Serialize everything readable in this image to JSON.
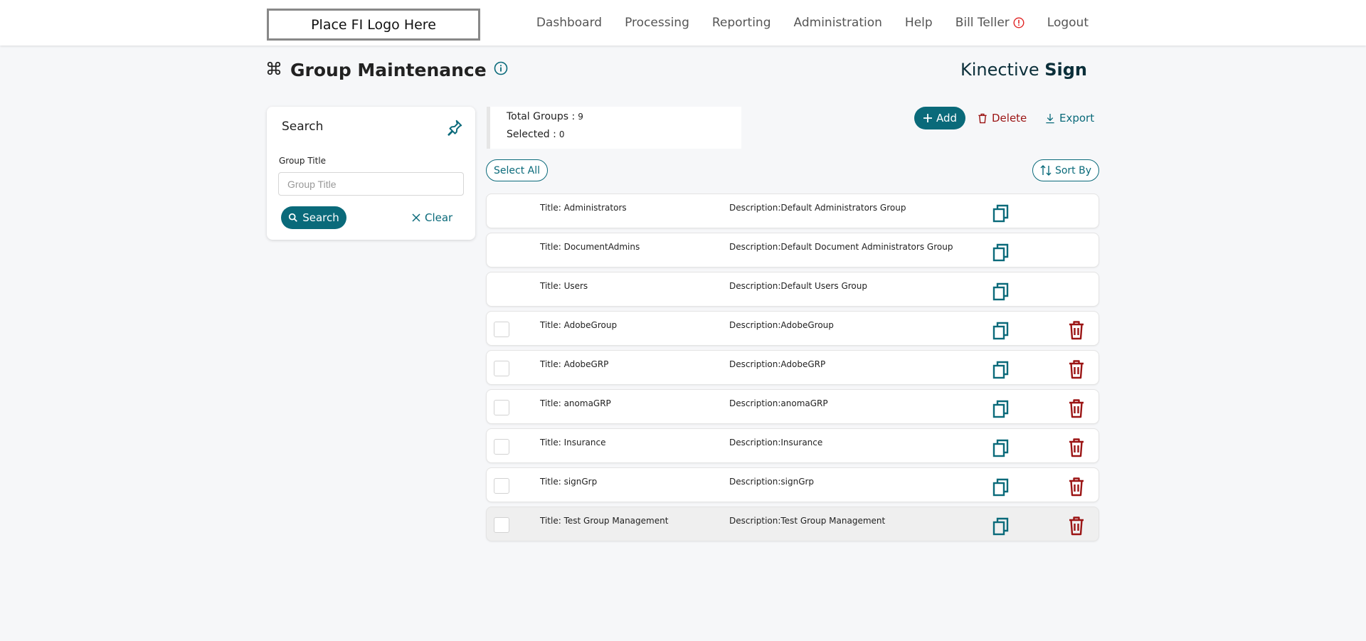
{
  "header": {
    "logo_text": "Place FI Logo Here",
    "nav": [
      {
        "label": "Dashboard"
      },
      {
        "label": "Processing"
      },
      {
        "label": "Reporting"
      },
      {
        "label": "Administration"
      },
      {
        "label": "Help"
      },
      {
        "label": "Bill Teller"
      },
      {
        "label": "Logout"
      }
    ]
  },
  "page": {
    "title": "Group Maintenance",
    "brand_light": "Kinective",
    "brand_bold": "Sign"
  },
  "search": {
    "card_title": "Search",
    "group_title_label": "Group Title",
    "group_title_placeholder": "Group Title",
    "group_title_value": "",
    "search_label": "Search",
    "clear_label": "Clear"
  },
  "summary": {
    "total_label": "Total Groups :",
    "total_value": "9",
    "selected_label": "Selected :",
    "selected_value": "0"
  },
  "actions": {
    "add_label": "Add",
    "delete_label": "Delete",
    "export_label": "Export",
    "select_all_label": "Select All",
    "sort_by_label": "Sort By"
  },
  "colors": {
    "accent": "#0a6a7a",
    "danger": "#9b1414",
    "alert": "#e02424"
  },
  "groups": [
    {
      "title": "Title: Administrators",
      "description": "Description:Default Administrators Group",
      "selectable": false,
      "deletable": false
    },
    {
      "title": "Title: DocumentAdmins",
      "description": "Description:Default Document Administrators Group",
      "selectable": false,
      "deletable": false
    },
    {
      "title": "Title: Users",
      "description": "Description:Default Users Group",
      "selectable": false,
      "deletable": false
    },
    {
      "title": "Title: AdobeGroup",
      "description": "Description:AdobeGroup",
      "selectable": true,
      "deletable": true
    },
    {
      "title": "Title: AdobeGRP",
      "description": "Description:AdobeGRP",
      "selectable": true,
      "deletable": true
    },
    {
      "title": "Title: anomaGRP",
      "description": "Description:anomaGRP",
      "selectable": true,
      "deletable": true
    },
    {
      "title": "Title: Insurance",
      "description": "Description:Insurance",
      "selectable": true,
      "deletable": true
    },
    {
      "title": "Title: signGrp",
      "description": "Description:signGrp",
      "selectable": true,
      "deletable": true
    },
    {
      "title": "Title: Test Group Management",
      "description": "Description:Test Group Management",
      "selectable": true,
      "deletable": true,
      "highlighted": true
    }
  ]
}
